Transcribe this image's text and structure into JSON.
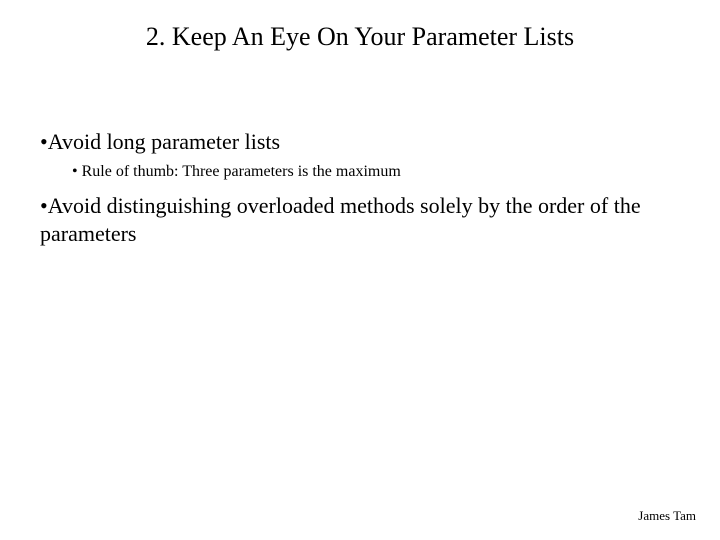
{
  "title": "2. Keep An Eye On Your Parameter Lists",
  "bullets": {
    "item1": "Avoid long parameter lists",
    "item1_sub1": "Rule of thumb: Three parameters is the maximum",
    "item2": "Avoid distinguishing overloaded methods solely by the order of the parameters"
  },
  "footer": "James Tam",
  "glyphs": {
    "bullet": "•"
  }
}
